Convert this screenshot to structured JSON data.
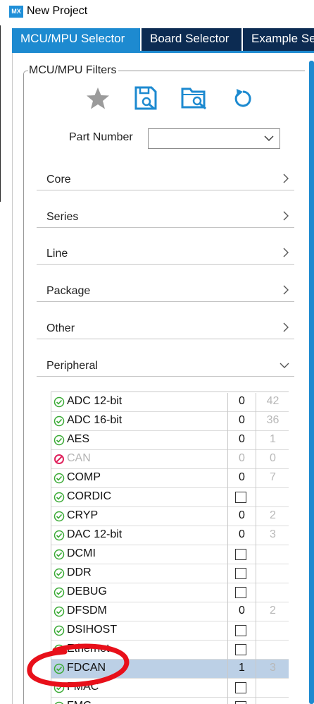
{
  "window": {
    "logo_text": "MX",
    "title": "New Project"
  },
  "tabs": [
    {
      "label": "MCU/MPU Selector",
      "active": true
    },
    {
      "label": "Board Selector",
      "active": false
    },
    {
      "label": "Example Selector",
      "active": false
    }
  ],
  "filters": {
    "group_title": "MCU/MPU Filters",
    "toolbar_icons": [
      "star-icon",
      "save-search-icon",
      "open-search-icon",
      "reset-icon"
    ],
    "part_number": {
      "label": "Part Number",
      "value": ""
    },
    "sections": [
      {
        "label": "Core",
        "expanded": false
      },
      {
        "label": "Series",
        "expanded": false
      },
      {
        "label": "Line",
        "expanded": false
      },
      {
        "label": "Package",
        "expanded": false
      },
      {
        "label": "Other",
        "expanded": false
      },
      {
        "label": "Peripheral",
        "expanded": true
      }
    ]
  },
  "peripherals": [
    {
      "name": "ADC 12-bit",
      "status": "available",
      "count": "0",
      "total": "42",
      "checkbox": false
    },
    {
      "name": "ADC 16-bit",
      "status": "available",
      "count": "0",
      "total": "36",
      "checkbox": false
    },
    {
      "name": "AES",
      "status": "available",
      "count": "0",
      "total": "1",
      "checkbox": false
    },
    {
      "name": "CAN",
      "status": "unavailable",
      "count": "0",
      "total": "0",
      "checkbox": false
    },
    {
      "name": "COMP",
      "status": "available",
      "count": "0",
      "total": "7",
      "checkbox": false
    },
    {
      "name": "CORDIC",
      "status": "available",
      "count": "",
      "total": "",
      "checkbox": true
    },
    {
      "name": "CRYP",
      "status": "available",
      "count": "0",
      "total": "2",
      "checkbox": false
    },
    {
      "name": "DAC 12-bit",
      "status": "available",
      "count": "0",
      "total": "3",
      "checkbox": false
    },
    {
      "name": "DCMI",
      "status": "available",
      "count": "",
      "total": "",
      "checkbox": true
    },
    {
      "name": "DDR",
      "status": "available",
      "count": "",
      "total": "",
      "checkbox": true
    },
    {
      "name": "DEBUG",
      "status": "available",
      "count": "",
      "total": "",
      "checkbox": true
    },
    {
      "name": "DFSDM",
      "status": "available",
      "count": "0",
      "total": "2",
      "checkbox": false
    },
    {
      "name": "DSIHOST",
      "status": "available",
      "count": "",
      "total": "",
      "checkbox": true
    },
    {
      "name": "Ethernet",
      "status": "available",
      "count": "",
      "total": "",
      "checkbox": true
    },
    {
      "name": "FDCAN",
      "status": "available",
      "count": "1",
      "total": "3",
      "checkbox": false,
      "selected": true
    },
    {
      "name": "FMAC",
      "status": "available",
      "count": "",
      "total": "",
      "checkbox": true
    },
    {
      "name": "FMC",
      "status": "available",
      "count": "",
      "total": "",
      "checkbox": true
    }
  ],
  "colors": {
    "tab_bar": "#0c2b52",
    "tab_active": "#1d8ad0",
    "status_ok": "#3aaa35",
    "status_blocked": "#e0245e",
    "selected_row": "#bcd0e6",
    "annotation": "#e8101a"
  }
}
